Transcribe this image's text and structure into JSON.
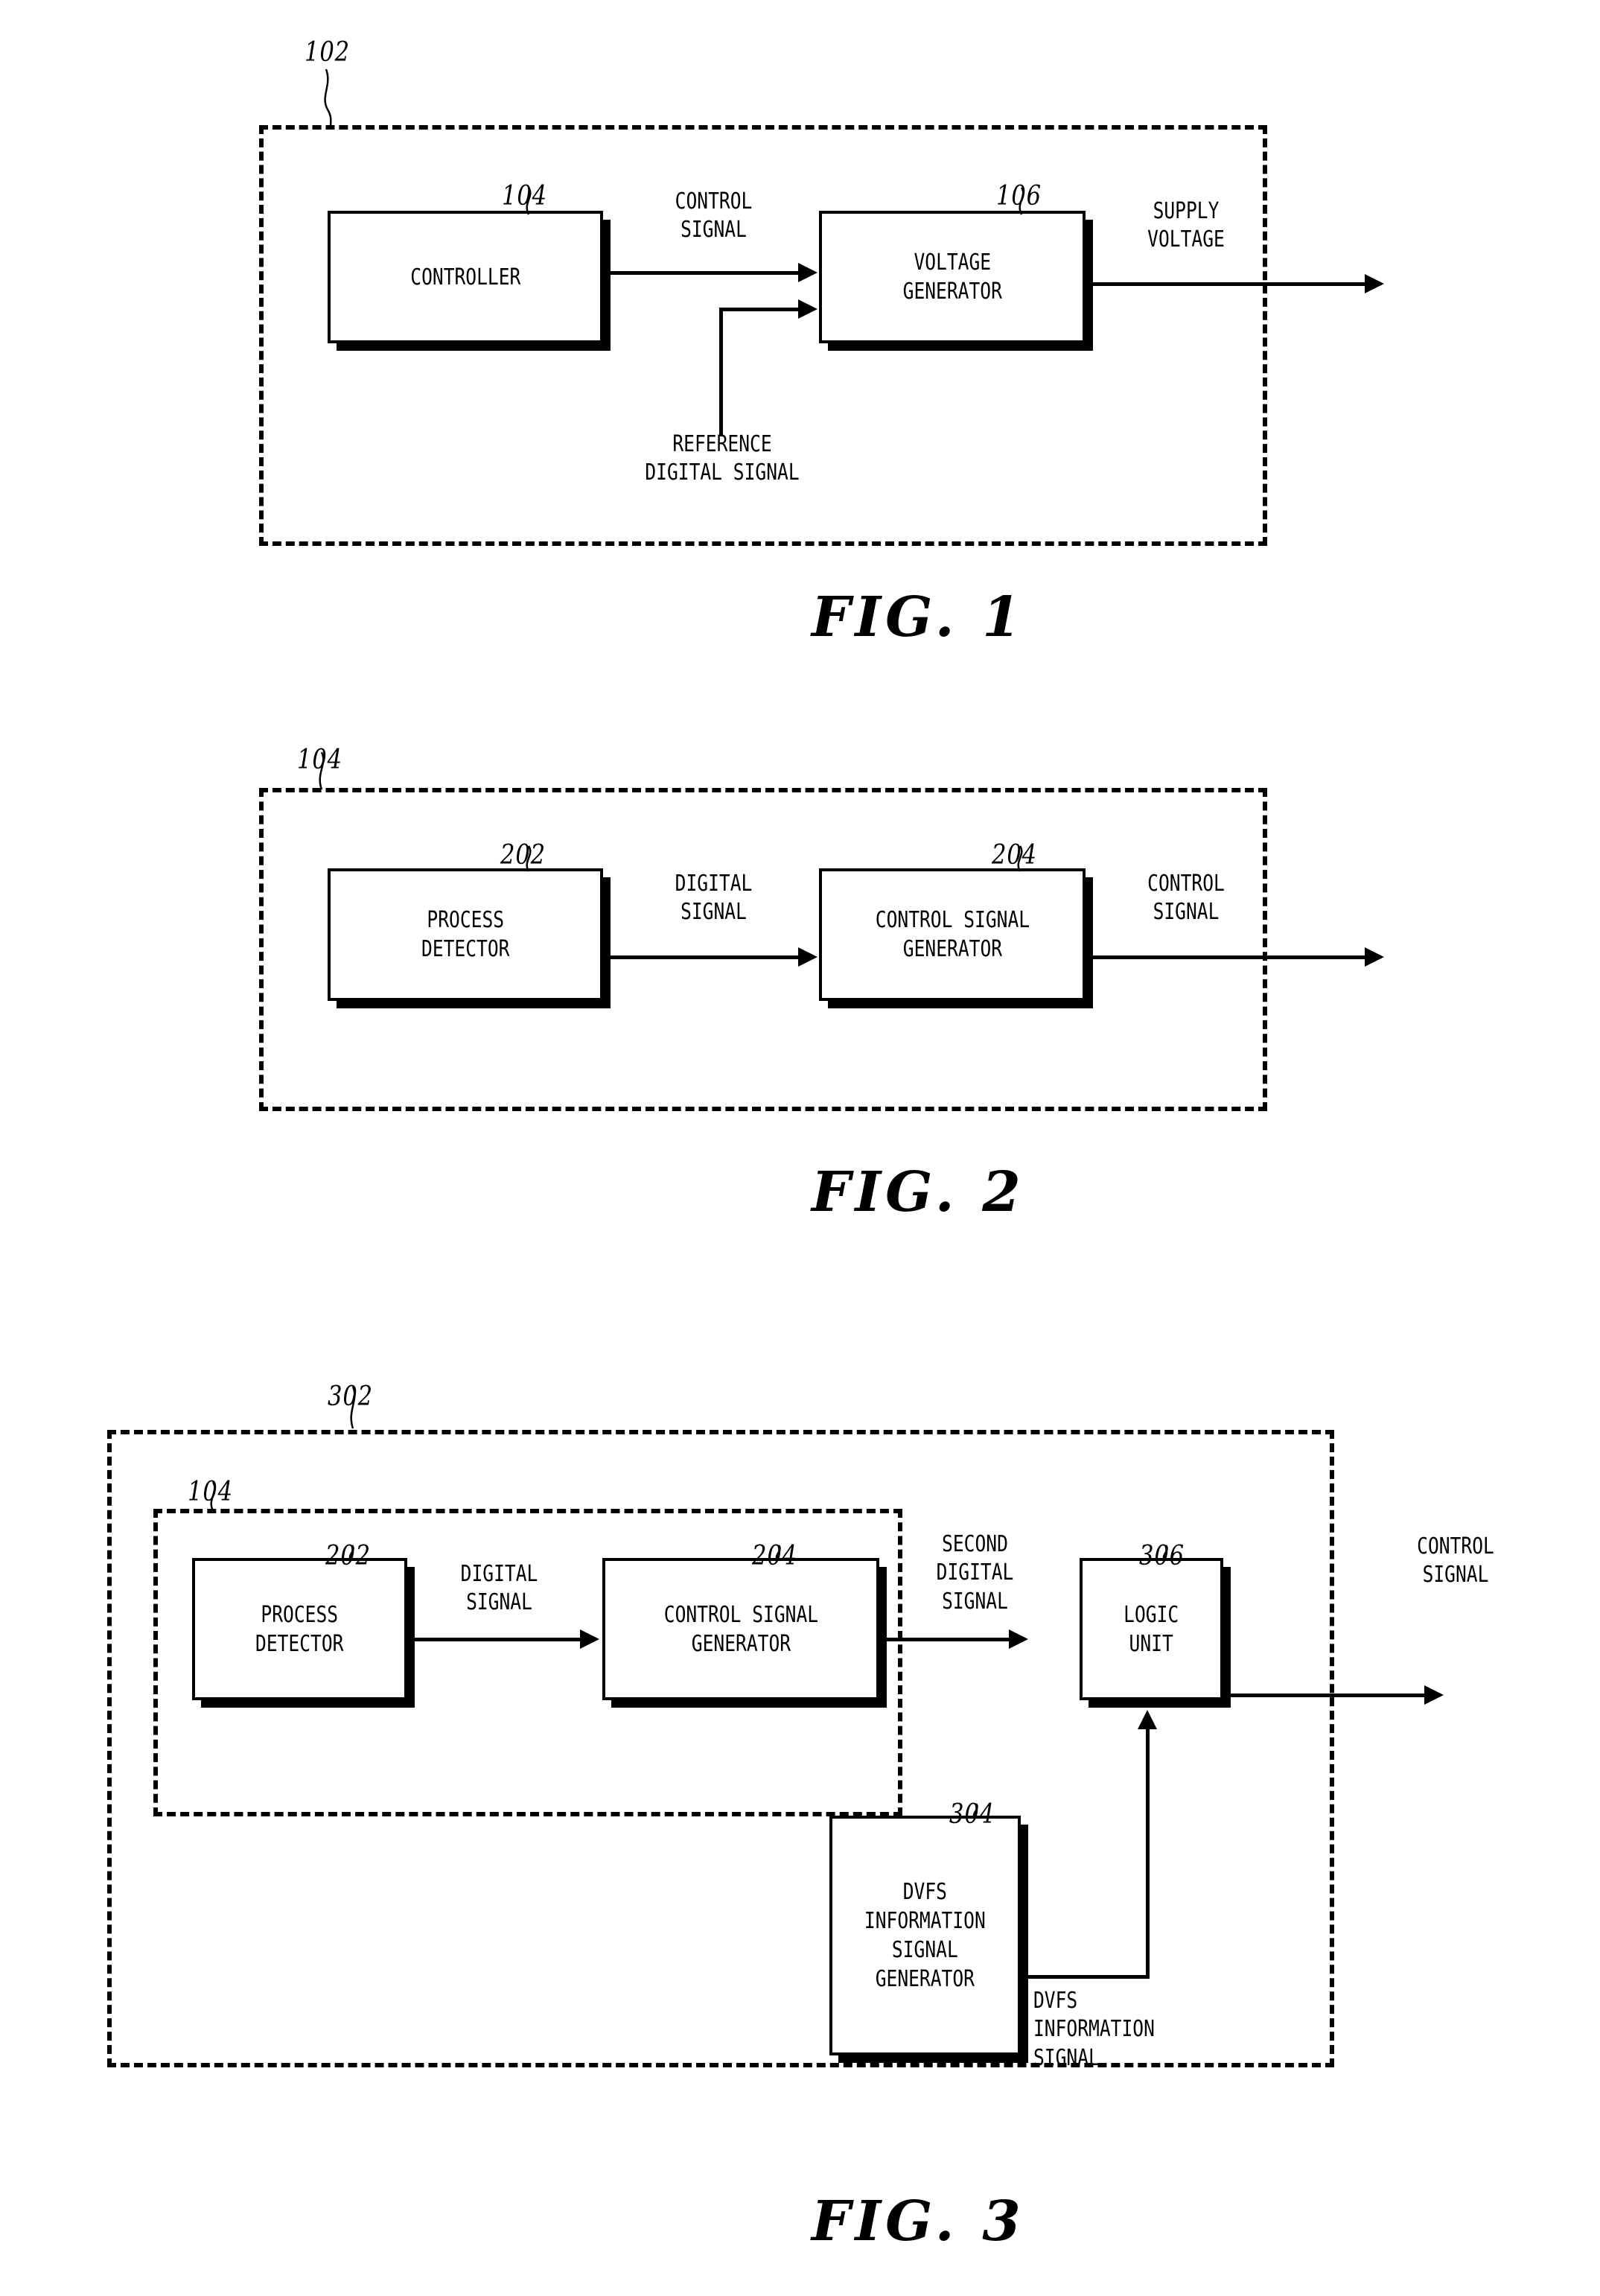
{
  "document": {
    "type": "patent-drawing-sheet",
    "figures": [
      {
        "id": "fig1",
        "caption": "FIG. 1",
        "outer_ref": "102",
        "blocks": [
          {
            "ref": "104",
            "label": "CONTROLLER"
          },
          {
            "ref": "106",
            "label": "VOLTAGE\nGENERATOR"
          }
        ],
        "signals": [
          {
            "name": "control-signal",
            "label": "CONTROL\nSIGNAL"
          },
          {
            "name": "supply-voltage",
            "label": "SUPPLY\nVOLTAGE"
          },
          {
            "name": "reference-digital-signal",
            "label": "REFERENCE\nDIGITAL SIGNAL"
          }
        ]
      },
      {
        "id": "fig2",
        "caption": "FIG. 2",
        "outer_ref": "104",
        "blocks": [
          {
            "ref": "202",
            "label": "PROCESS\nDETECTOR"
          },
          {
            "ref": "204",
            "label": "CONTROL SIGNAL\nGENERATOR"
          }
        ],
        "signals": [
          {
            "name": "digital-signal",
            "label": "DIGITAL\nSIGNAL"
          },
          {
            "name": "control-signal",
            "label": "CONTROL\nSIGNAL"
          }
        ]
      },
      {
        "id": "fig3",
        "caption": "FIG. 3",
        "outer_ref": "302",
        "inner_ref": "104",
        "blocks": [
          {
            "ref": "202",
            "label": "PROCESS\nDETECTOR"
          },
          {
            "ref": "204",
            "label": "CONTROL SIGNAL\nGENERATOR"
          },
          {
            "ref": "306",
            "label": "LOGIC\nUNIT"
          },
          {
            "ref": "304",
            "label": "DVFS\nINFORMATION\nSIGNAL\nGENERATOR"
          }
        ],
        "signals": [
          {
            "name": "digital-signal",
            "label": "DIGITAL\nSIGNAL"
          },
          {
            "name": "second-digital-signal",
            "label": "SECOND\nDIGITAL\nSIGNAL"
          },
          {
            "name": "control-signal",
            "label": "CONTROL\nSIGNAL"
          },
          {
            "name": "dvfs-information-signal",
            "label": "DVFS\nINFORMATION\nSIGNAL"
          }
        ]
      }
    ]
  },
  "fig1": {
    "ref_outer": "102",
    "ref_controller": "104",
    "ref_voltage_generator": "106",
    "block_controller": "CONTROLLER",
    "block_voltage_generator": "VOLTAGE\nGENERATOR",
    "sig_control": "CONTROL\nSIGNAL",
    "sig_supply": "SUPPLY\nVOLTAGE",
    "sig_reference": "REFERENCE\nDIGITAL SIGNAL",
    "caption": "FIG. 1"
  },
  "fig2": {
    "ref_outer": "104",
    "ref_process_detector": "202",
    "ref_control_signal_generator": "204",
    "block_process_detector": "PROCESS\nDETECTOR",
    "block_control_signal_generator": "CONTROL SIGNAL\nGENERATOR",
    "sig_digital": "DIGITAL\nSIGNAL",
    "sig_control": "CONTROL\nSIGNAL",
    "caption": "FIG. 2"
  },
  "fig3": {
    "ref_outer": "302",
    "ref_inner": "104",
    "ref_process_detector": "202",
    "ref_control_signal_generator": "204",
    "ref_logic_unit": "306",
    "ref_dvfs_generator": "304",
    "block_process_detector": "PROCESS\nDETECTOR",
    "block_control_signal_generator": "CONTROL SIGNAL\nGENERATOR",
    "block_logic_unit": "LOGIC\nUNIT",
    "block_dvfs_generator": "DVFS\nINFORMATION\nSIGNAL\nGENERATOR",
    "sig_digital": "DIGITAL\nSIGNAL",
    "sig_second_digital": "SECOND\nDIGITAL\nSIGNAL",
    "sig_control": "CONTROL\nSIGNAL",
    "sig_dvfs": "DVFS\nINFORMATION\nSIGNAL",
    "caption": "FIG. 3"
  }
}
